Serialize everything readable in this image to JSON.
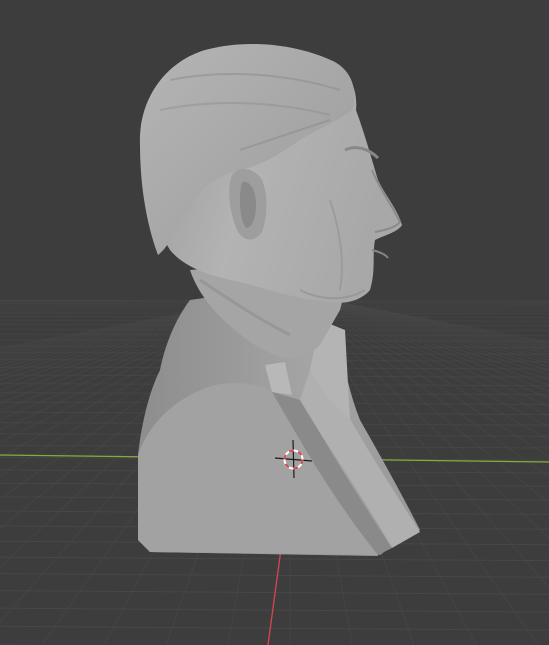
{
  "viewport": {
    "mode": "solid-shading",
    "object": "bust-sculpture",
    "background_color": "#3d3d3d",
    "grid_color": "#4a4a4a",
    "x_axis_color": "#d94452",
    "y_axis_color": "#85ad3a",
    "mesh_color": "#a6a6a6",
    "cursor_colors": [
      "#d94452",
      "#ffffff",
      "#1a1a1a"
    ]
  }
}
